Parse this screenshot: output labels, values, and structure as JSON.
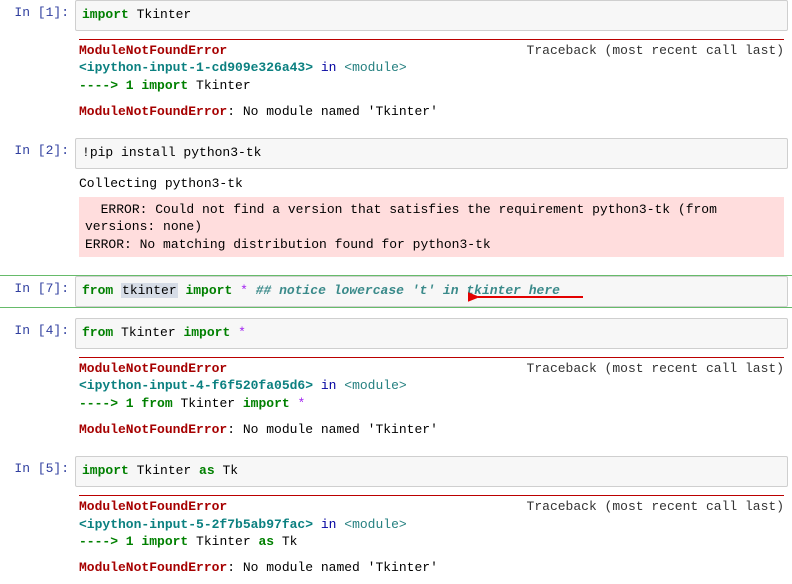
{
  "cells": [
    {
      "prompt": "In [1]:",
      "code": [
        {
          "t": "import",
          "c": "kw-green"
        },
        {
          "t": " Tkinter"
        }
      ],
      "tb": {
        "err": "ModuleNotFoundError",
        "right": "Traceback (most recent call last)",
        "loc_pre": "<ipython-input-1-cd909e326a43>",
        "loc_in": " in ",
        "loc_mod": "<module>",
        "arrowline": [
          {
            "t": "----> 1 ",
            "c": "tb-green"
          },
          {
            "t": "import",
            "c": "kw-green"
          },
          {
            "t": " Tkinter"
          }
        ],
        "final_pre": "ModuleNotFoundError",
        "final_post": ": No module named 'Tkinter'"
      }
    },
    {
      "prompt": "In [2]:",
      "code": [
        {
          "t": "!"
        },
        {
          "t": "pip install python3-tk"
        }
      ],
      "output": {
        "collecting": "Collecting python3-tk",
        "err1": "  ERROR: Could not find a version that satisfies the requirement python3-tk (from versions: none)",
        "err2": "ERROR: No matching distribution found for python3-tk"
      }
    },
    {
      "prompt": "In [7]:",
      "selected": true,
      "code": [
        {
          "t": "from",
          "c": "kw-green"
        },
        {
          "t": " "
        },
        {
          "t": "tkinter",
          "c": "highlight-word"
        },
        {
          "t": " "
        },
        {
          "t": "import",
          "c": "kw-green"
        },
        {
          "t": " "
        },
        {
          "t": "*",
          "c": "op-purple"
        },
        {
          "t": "   "
        },
        {
          "t": "## notice lowercase 't' in tkinter here",
          "c": "comment-cyan"
        }
      ]
    },
    {
      "prompt": "In [4]:",
      "code": [
        {
          "t": "from",
          "c": "kw-green"
        },
        {
          "t": " Tkinter "
        },
        {
          "t": "import",
          "c": "kw-green"
        },
        {
          "t": " "
        },
        {
          "t": "*",
          "c": "op-purple"
        }
      ],
      "tb": {
        "err": "ModuleNotFoundError",
        "right": "Traceback (most recent call last)",
        "loc_pre": "<ipython-input-4-f6f520fa05d6>",
        "loc_in": " in ",
        "loc_mod": "<module>",
        "arrowline": [
          {
            "t": "----> 1 ",
            "c": "tb-green"
          },
          {
            "t": "from",
            "c": "kw-green"
          },
          {
            "t": " Tkinter "
          },
          {
            "t": "import",
            "c": "kw-green"
          },
          {
            "t": " "
          },
          {
            "t": "*",
            "c": "op-purple"
          }
        ],
        "final_pre": "ModuleNotFoundError",
        "final_post": ": No module named 'Tkinter'"
      }
    },
    {
      "prompt": "In [5]:",
      "code": [
        {
          "t": "import",
          "c": "kw-green"
        },
        {
          "t": " Tkinter "
        },
        {
          "t": "as",
          "c": "kw-green"
        },
        {
          "t": " Tk"
        }
      ],
      "tb": {
        "err": "ModuleNotFoundError",
        "right": "Traceback (most recent call last)",
        "loc_pre": "<ipython-input-5-2f7b5ab97fac>",
        "loc_in": " in ",
        "loc_mod": "<module>",
        "arrowline": [
          {
            "t": "----> 1 ",
            "c": "tb-green"
          },
          {
            "t": "import",
            "c": "kw-green"
          },
          {
            "t": " Tkinter "
          },
          {
            "t": "as",
            "c": "kw-green"
          },
          {
            "t": " Tk"
          }
        ],
        "final_pre": "ModuleNotFoundError",
        "final_post": ": No module named 'Tkinter'"
      }
    }
  ]
}
